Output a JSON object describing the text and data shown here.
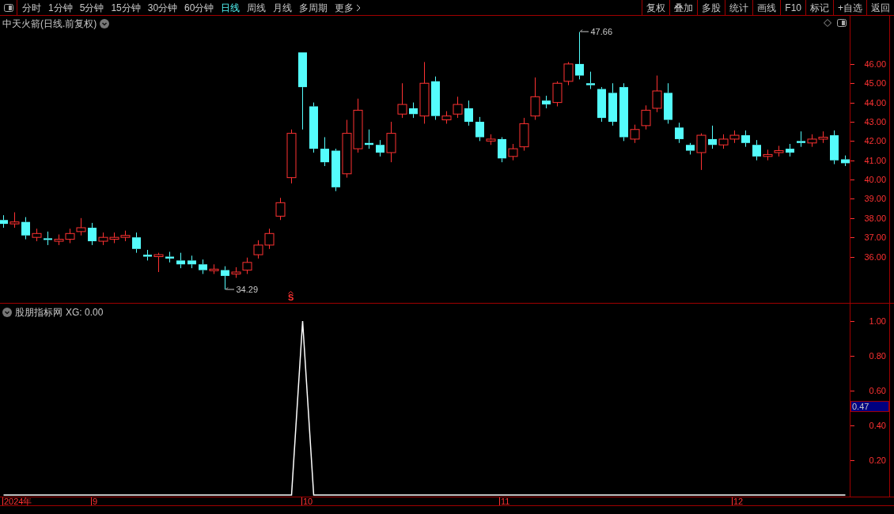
{
  "toolbar": {
    "periods": [
      {
        "label": "分时",
        "selected": false
      },
      {
        "label": "1分钟",
        "selected": false
      },
      {
        "label": "5分钟",
        "selected": false
      },
      {
        "label": "15分钟",
        "selected": false
      },
      {
        "label": "30分钟",
        "selected": false
      },
      {
        "label": "60分钟",
        "selected": false
      },
      {
        "label": "日线",
        "selected": true
      },
      {
        "label": "周线",
        "selected": false
      },
      {
        "label": "月线",
        "selected": false
      },
      {
        "label": "多周期",
        "selected": false
      }
    ],
    "more": "更多",
    "buttons": [
      "复权",
      "叠加",
      "多股",
      "统计",
      "画线",
      "F10",
      "标记",
      "+自选",
      "返回"
    ]
  },
  "price_chart": {
    "title": "中天火箭(日线.前复权)",
    "high_label": "47.66",
    "low_label": "34.29",
    "signal": "S",
    "chart_data": {
      "type": "candlestick",
      "ohlc": [
        [
          37.9,
          38.15,
          37.5,
          37.7
        ],
        [
          37.7,
          38.3,
          37.5,
          37.8
        ],
        [
          37.8,
          38.05,
          36.9,
          37.1
        ],
        [
          37.0,
          37.45,
          36.8,
          37.2
        ],
        [
          36.95,
          37.3,
          36.6,
          36.9
        ],
        [
          36.8,
          37.15,
          36.6,
          36.9
        ],
        [
          36.9,
          37.45,
          36.7,
          37.2
        ],
        [
          37.3,
          38.0,
          37.1,
          37.5
        ],
        [
          37.5,
          37.75,
          36.6,
          36.8
        ],
        [
          36.8,
          37.25,
          36.6,
          37.0
        ],
        [
          36.9,
          37.25,
          36.7,
          37.0
        ],
        [
          37.0,
          37.35,
          36.8,
          37.1
        ],
        [
          37.0,
          37.25,
          36.2,
          36.4
        ],
        [
          36.1,
          36.35,
          35.8,
          36.0
        ],
        [
          36.0,
          36.2,
          35.2,
          36.1
        ],
        [
          36.0,
          36.25,
          35.7,
          35.9
        ],
        [
          35.8,
          36.2,
          35.4,
          35.6
        ],
        [
          35.8,
          36.05,
          35.4,
          35.6
        ],
        [
          35.6,
          35.85,
          35.1,
          35.3
        ],
        [
          35.3,
          35.6,
          35.1,
          35.35
        ],
        [
          35.3,
          35.5,
          34.29,
          35.0
        ],
        [
          35.1,
          35.45,
          34.9,
          35.2
        ],
        [
          35.3,
          35.95,
          35.1,
          35.7
        ],
        [
          36.1,
          36.85,
          35.9,
          36.6
        ],
        [
          36.6,
          37.45,
          36.4,
          37.2
        ],
        [
          38.1,
          39.05,
          37.9,
          38.8
        ],
        [
          40.1,
          42.6,
          39.8,
          42.4
        ],
        [
          46.6,
          46.6,
          42.6,
          44.8
        ],
        [
          43.8,
          44.0,
          41.4,
          41.6
        ],
        [
          41.6,
          42.2,
          40.7,
          40.9
        ],
        [
          41.5,
          41.6,
          39.4,
          39.6
        ],
        [
          40.3,
          43.1,
          40.1,
          42.4
        ],
        [
          41.6,
          44.2,
          41.4,
          43.6
        ],
        [
          41.9,
          42.6,
          41.6,
          41.8
        ],
        [
          41.8,
          42.05,
          41.2,
          41.4
        ],
        [
          41.4,
          43.0,
          40.9,
          42.4
        ],
        [
          43.4,
          45.0,
          43.2,
          43.9
        ],
        [
          43.7,
          44.0,
          43.2,
          43.4
        ],
        [
          43.3,
          46.1,
          42.9,
          45.0
        ],
        [
          45.1,
          45.35,
          43.1,
          43.3
        ],
        [
          43.1,
          43.55,
          42.9,
          43.3
        ],
        [
          43.4,
          44.3,
          43.2,
          43.9
        ],
        [
          43.7,
          44.1,
          42.8,
          43.0
        ],
        [
          43.0,
          43.25,
          42.0,
          42.2
        ],
        [
          42.0,
          42.35,
          41.8,
          42.1
        ],
        [
          42.1,
          42.2,
          40.9,
          41.1
        ],
        [
          41.2,
          41.85,
          41.0,
          41.6
        ],
        [
          41.7,
          43.2,
          41.5,
          42.9
        ],
        [
          43.3,
          45.3,
          43.1,
          44.3
        ],
        [
          44.1,
          44.35,
          43.7,
          43.9
        ],
        [
          44.0,
          45.1,
          43.8,
          45.0
        ],
        [
          45.1,
          46.1,
          44.9,
          46.0
        ],
        [
          46.0,
          47.66,
          45.2,
          45.4
        ],
        [
          45.0,
          45.6,
          44.7,
          44.9
        ],
        [
          44.7,
          44.8,
          43.0,
          43.2
        ],
        [
          44.5,
          45.0,
          42.8,
          43.0
        ],
        [
          44.8,
          45.0,
          42.0,
          42.2
        ],
        [
          42.1,
          42.85,
          41.9,
          42.6
        ],
        [
          42.8,
          43.85,
          42.6,
          43.6
        ],
        [
          43.7,
          45.4,
          43.5,
          44.6
        ],
        [
          44.5,
          45.0,
          42.9,
          43.1
        ],
        [
          42.7,
          42.95,
          41.9,
          42.1
        ],
        [
          41.8,
          41.9,
          41.3,
          41.5
        ],
        [
          41.4,
          42.4,
          40.5,
          42.3
        ],
        [
          42.1,
          42.8,
          41.6,
          41.8
        ],
        [
          41.8,
          42.35,
          41.6,
          42.1
        ],
        [
          42.1,
          42.55,
          41.9,
          42.3
        ],
        [
          42.3,
          42.55,
          41.7,
          41.9
        ],
        [
          41.8,
          42.05,
          41.0,
          41.2
        ],
        [
          41.2,
          41.55,
          41.0,
          41.3
        ],
        [
          41.4,
          41.75,
          41.2,
          41.5
        ],
        [
          41.6,
          41.85,
          41.2,
          41.4
        ],
        [
          42.0,
          42.5,
          41.7,
          41.9
        ],
        [
          41.9,
          42.35,
          41.7,
          42.1
        ],
        [
          42.1,
          42.5,
          41.9,
          42.2
        ],
        [
          42.3,
          42.55,
          40.8,
          41.0
        ],
        [
          41.05,
          41.25,
          40.7,
          40.85
        ]
      ],
      "ylim": [
        33.6,
        48.5
      ],
      "yticks": [
        {
          "value": 46,
          "label": "46.00"
        },
        {
          "value": 45,
          "label": "45.00"
        },
        {
          "value": 44,
          "label": "44.00"
        },
        {
          "value": 43,
          "label": "43.00"
        },
        {
          "value": 42,
          "label": "42.00"
        },
        {
          "value": 41,
          "label": "41.00"
        },
        {
          "value": 40,
          "label": "40.00"
        },
        {
          "value": 39,
          "label": "39.00"
        },
        {
          "value": 38,
          "label": "38.00"
        },
        {
          "value": 37,
          "label": "37.00"
        },
        {
          "value": 36,
          "label": "36.00"
        }
      ]
    }
  },
  "indicator": {
    "name": "股朋指标网",
    "reading": "XG: 0.00",
    "cursor_value": "0.47",
    "chart_data": {
      "type": "line",
      "series": [
        {
          "color": "#ffffff",
          "values": [
            0,
            0,
            0,
            0,
            0,
            0,
            0,
            0,
            0,
            0,
            0,
            0,
            0,
            0,
            0,
            0,
            0,
            0,
            0,
            0,
            0,
            0,
            0,
            0,
            0,
            0,
            0,
            1,
            0,
            0,
            0,
            0,
            0,
            0,
            0,
            0,
            0,
            0,
            0,
            0,
            0,
            0,
            0,
            0,
            0,
            0,
            0,
            0,
            0,
            0,
            0,
            0,
            0,
            0,
            0,
            0,
            0,
            0,
            0,
            0,
            0,
            0,
            0,
            0,
            0,
            0,
            0,
            0,
            0,
            0,
            0,
            0,
            0,
            0,
            0,
            0,
            0
          ]
        }
      ],
      "ylim": [
        0,
        1.1
      ],
      "yticks": [
        {
          "value": 0.2,
          "label": "0.20"
        },
        {
          "value": 0.4,
          "label": "0.40"
        },
        {
          "value": 0.6,
          "label": "0.60"
        },
        {
          "value": 0.8,
          "label": "0.80"
        },
        {
          "value": 1,
          "label": "1.00"
        }
      ]
    }
  },
  "date_axis": [
    "2024年",
    "9",
    "10",
    "11",
    "12"
  ]
}
